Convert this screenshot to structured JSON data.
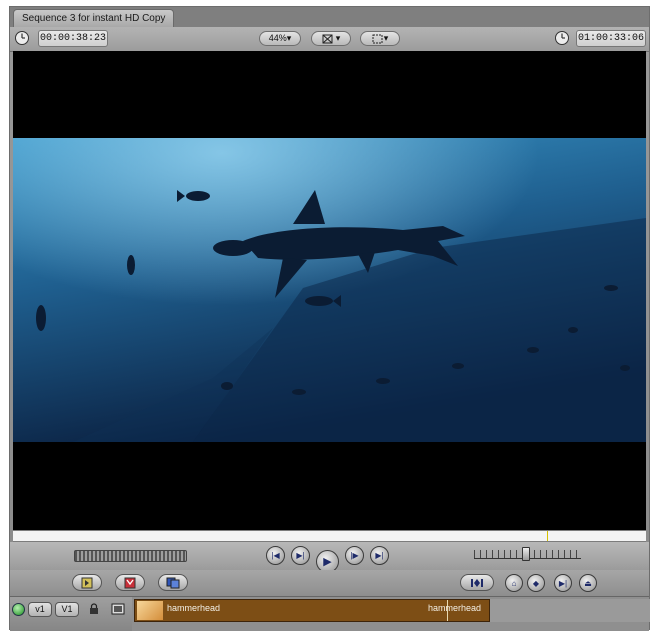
{
  "window": {
    "tab_title": "Sequence 3 for instant HD Copy"
  },
  "topbar": {
    "left_timecode": "00:00:38:23",
    "zoom_label": "44%",
    "right_timecode": "01:00:33:06",
    "clock_icon": "clock-icon",
    "zoom_arrow": "▾",
    "view_arrow": "▾"
  },
  "track": {
    "v_source": "v1",
    "v_dest": "V1",
    "clip_label_left": "hammerhead",
    "clip_label_right": "hammerhead"
  },
  "colors": {
    "water_top": "#3a97c9",
    "water_bottom": "#0a1f3f",
    "clip_brown": "#7d4e15",
    "playhead_yellow": "#d6c200"
  }
}
